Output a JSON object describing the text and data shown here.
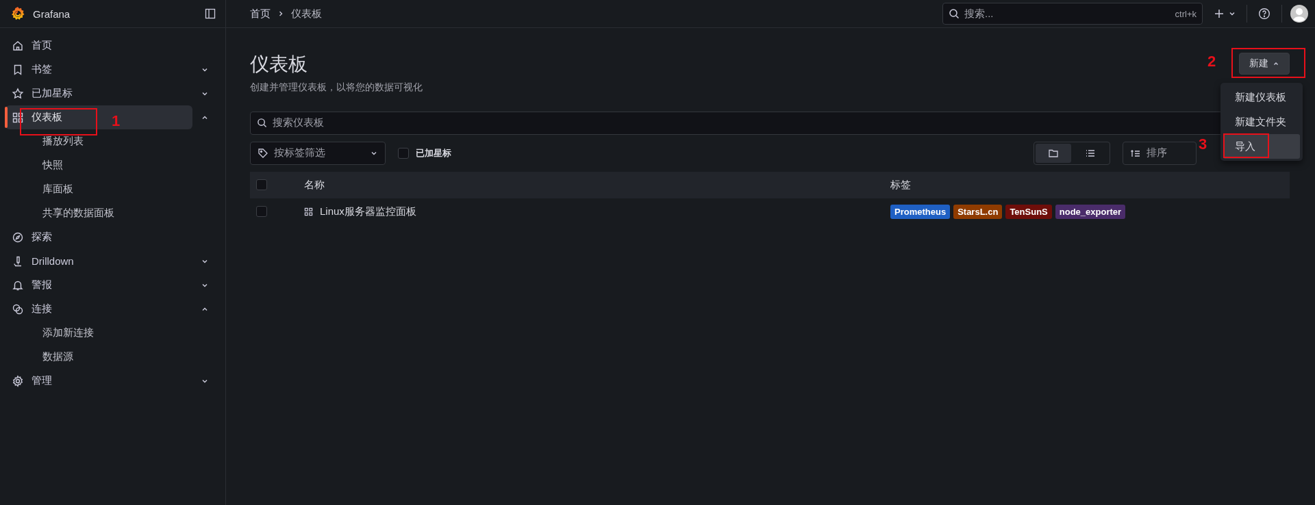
{
  "brand": {
    "name": "Grafana"
  },
  "sidebar": {
    "items": [
      {
        "label": "首页",
        "kind": "link",
        "selected": false
      },
      {
        "label": "书签",
        "kind": "group",
        "expanded": false,
        "selected": false
      },
      {
        "label": "已加星标",
        "kind": "group",
        "expanded": false,
        "selected": false
      },
      {
        "label": "仪表板",
        "kind": "group",
        "expanded": true,
        "selected": true,
        "children": [
          {
            "label": "播放列表"
          },
          {
            "label": "快照"
          },
          {
            "label": "库面板"
          },
          {
            "label": "共享的数据面板"
          }
        ]
      },
      {
        "label": "探索",
        "kind": "link",
        "selected": false
      },
      {
        "label": "Drilldown",
        "kind": "group",
        "expanded": false,
        "selected": false
      },
      {
        "label": "警报",
        "kind": "group",
        "expanded": false,
        "selected": false
      },
      {
        "label": "连接",
        "kind": "group",
        "expanded": true,
        "selected": false,
        "children": [
          {
            "label": "添加新连接"
          },
          {
            "label": "数据源"
          }
        ]
      },
      {
        "label": "管理",
        "kind": "group",
        "expanded": false,
        "selected": false
      }
    ]
  },
  "breadcrumbs": [
    "首页",
    "仪表板"
  ],
  "topbar": {
    "search": {
      "placeholder": "搜索...",
      "shortcut": "ctrl+k"
    }
  },
  "page": {
    "title": "仪表板",
    "subtitle": "创建并管理仪表板，以将您的数据可视化"
  },
  "new_button": {
    "label": "新建",
    "expanded": true
  },
  "new_menu": [
    {
      "label": "新建仪表板",
      "selected": false
    },
    {
      "label": "新建文件夹",
      "selected": false
    },
    {
      "label": "导入",
      "selected": true
    }
  ],
  "search": {
    "placeholder": "搜索仪表板"
  },
  "filters": {
    "tag_filter": {
      "placeholder": "按标签筛选"
    },
    "starred": {
      "label": "已加星标",
      "checked": false
    }
  },
  "view_toggle": [
    {
      "kind": "folder",
      "selected": true
    },
    {
      "kind": "list",
      "selected": false
    }
  ],
  "sort": {
    "placeholder": "排序"
  },
  "table": {
    "columns": [
      "名称",
      "标签"
    ],
    "header_checked": false,
    "rows": [
      {
        "name": "Linux服务器监控面板",
        "checked": false,
        "tags": [
          {
            "label": "Prometheus",
            "color": "#1f60c4"
          },
          {
            "label": "StarsL.cn",
            "color": "#8f3b00"
          },
          {
            "label": "TenSunS",
            "color": "#6e0e0a"
          },
          {
            "label": "node_exporter",
            "color": "#4a2c6a"
          }
        ]
      }
    ]
  },
  "annotations": [
    {
      "number": "1"
    },
    {
      "number": "2"
    },
    {
      "number": "3"
    }
  ]
}
